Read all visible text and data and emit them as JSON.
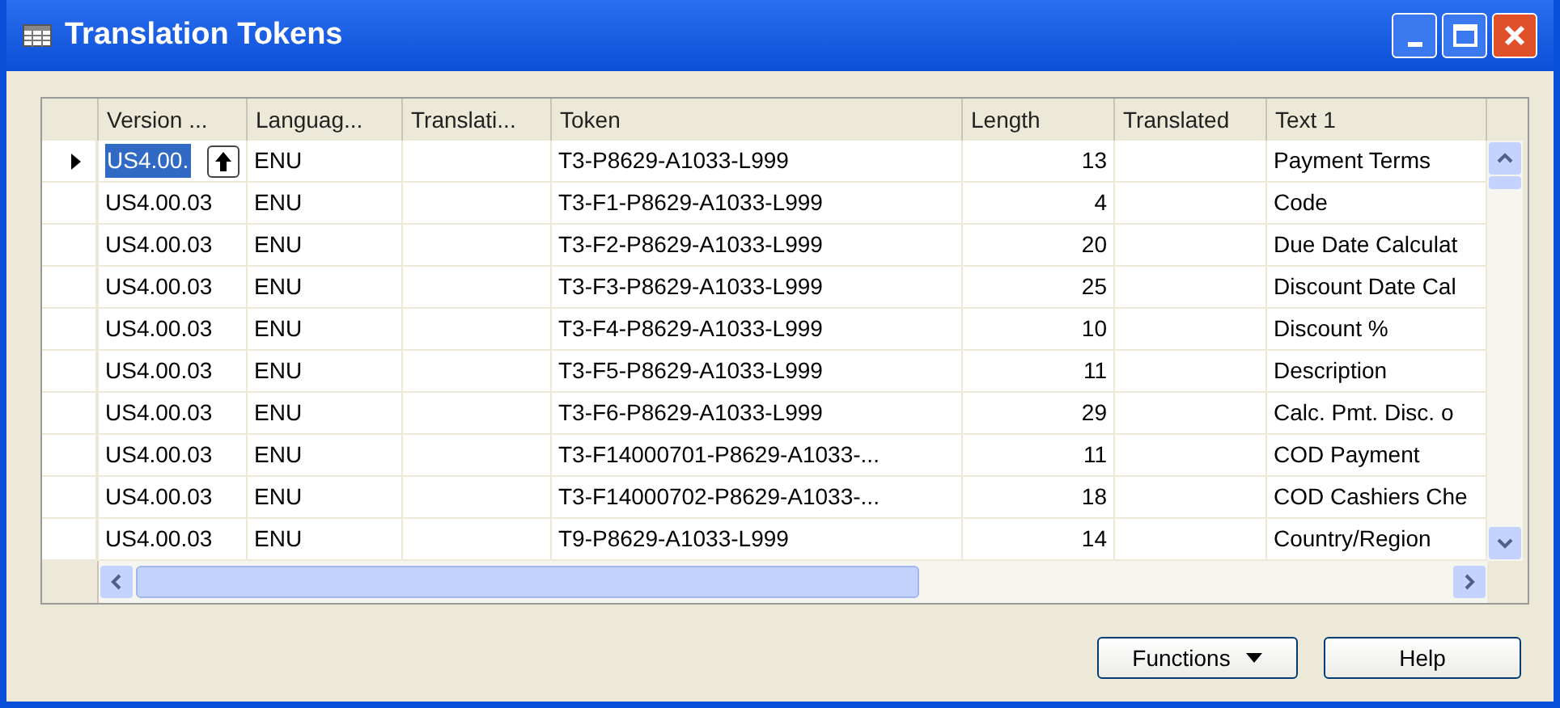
{
  "window": {
    "title": "Translation Tokens"
  },
  "table": {
    "columns": [
      "Version ...",
      "Languag...",
      "Translati...",
      "Token",
      "Length",
      "Translated",
      "Text 1"
    ],
    "rows": [
      {
        "selected": true,
        "cells": [
          "US4.00.",
          "ENU",
          null,
          "T3-P8629-A1033-L999",
          "13",
          null,
          "Payment Terms"
        ]
      },
      {
        "selected": false,
        "cells": [
          "US4.00.03",
          "ENU",
          null,
          "T3-F1-P8629-A1033-L999",
          "4",
          null,
          "Code"
        ]
      },
      {
        "selected": false,
        "cells": [
          "US4.00.03",
          "ENU",
          null,
          "T3-F2-P8629-A1033-L999",
          "20",
          null,
          "Due Date Calculat"
        ]
      },
      {
        "selected": false,
        "cells": [
          "US4.00.03",
          "ENU",
          null,
          "T3-F3-P8629-A1033-L999",
          "25",
          null,
          "Discount Date Cal"
        ]
      },
      {
        "selected": false,
        "cells": [
          "US4.00.03",
          "ENU",
          null,
          "T3-F4-P8629-A1033-L999",
          "10",
          null,
          "Discount %"
        ]
      },
      {
        "selected": false,
        "cells": [
          "US4.00.03",
          "ENU",
          null,
          "T3-F5-P8629-A1033-L999",
          "11",
          null,
          "Description"
        ]
      },
      {
        "selected": false,
        "cells": [
          "US4.00.03",
          "ENU",
          null,
          "T3-F6-P8629-A1033-L999",
          "29",
          null,
          "Calc. Pmt. Disc. o"
        ]
      },
      {
        "selected": false,
        "cells": [
          "US4.00.03",
          "ENU",
          null,
          "T3-F14000701-P8629-A1033-...",
          "11",
          null,
          "COD Payment"
        ]
      },
      {
        "selected": false,
        "cells": [
          "US4.00.03",
          "ENU",
          null,
          "T3-F14000702-P8629-A1033-...",
          "18",
          null,
          "COD Cashiers Che"
        ]
      },
      {
        "selected": false,
        "cells": [
          "US4.00.03",
          "ENU",
          null,
          "T9-P8629-A1033-L999",
          "14",
          null,
          "Country/Region"
        ]
      }
    ]
  },
  "buttons": [
    "Functions",
    "Help"
  ]
}
